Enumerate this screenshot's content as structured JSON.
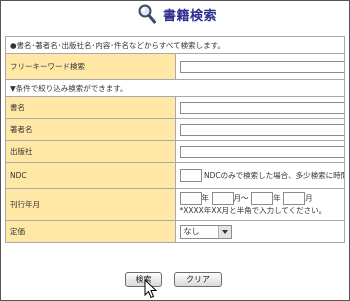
{
  "header": {
    "title": "書籍検索",
    "icon": "magnifier-icon"
  },
  "intro": "●書名･著者名･出版社名･内容･件名などからすべて検索します。",
  "freeword": {
    "label": "フリーキーワード検索",
    "value": ""
  },
  "filter_heading": "▼条件で絞り込み検索ができます。",
  "fields": {
    "title_label": "書名",
    "author_label": "著者名",
    "publisher_label": "出版社",
    "ndc_label": "NDC",
    "ndc_note": "NDCのみで検索した場合、多少検索に時間が掛かります。",
    "date_label": "刊行年月",
    "date_year_unit": "年",
    "date_month_unit": "月～",
    "date_year_unit2": "年",
    "date_month_unit2": "月",
    "date_note": "*XXXX年XX月と半角で入力してください。",
    "price_label": "定価",
    "price_selected": "なし"
  },
  "buttons": {
    "search": "検索",
    "clear": "クリア"
  },
  "colors": {
    "label_bg": "#ffe8a6",
    "title": "#2b2f8e",
    "border": "#a9a9a9"
  }
}
